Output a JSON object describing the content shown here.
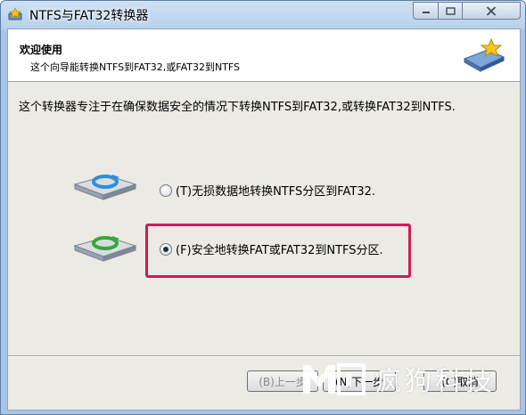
{
  "window": {
    "title": "NTFS与FAT32转换器"
  },
  "header": {
    "title": "欢迎使用",
    "subtitle": "这个向导能转换NTFS到FAT32,或FAT32到NTFS"
  },
  "body": {
    "description": "这个转换器专注于在确保数据安全的情况下转换NTFS到FAT32,或转换FAT32到NTFS.",
    "options": [
      {
        "label": "(T)无损数据地转换NTFS分区到FAT32.",
        "selected": false
      },
      {
        "label": "(F)安全地转换FAT或FAT32到NTFS分区.",
        "selected": true
      }
    ]
  },
  "footer": {
    "back_label": "(B)上一步",
    "next_label": "(N)下一步",
    "cancel_label": "(C)取消"
  },
  "watermark": {
    "text": "疯狗科技"
  },
  "colors": {
    "highlight": "#d4185a",
    "titlebar": "#b9d1ec"
  }
}
